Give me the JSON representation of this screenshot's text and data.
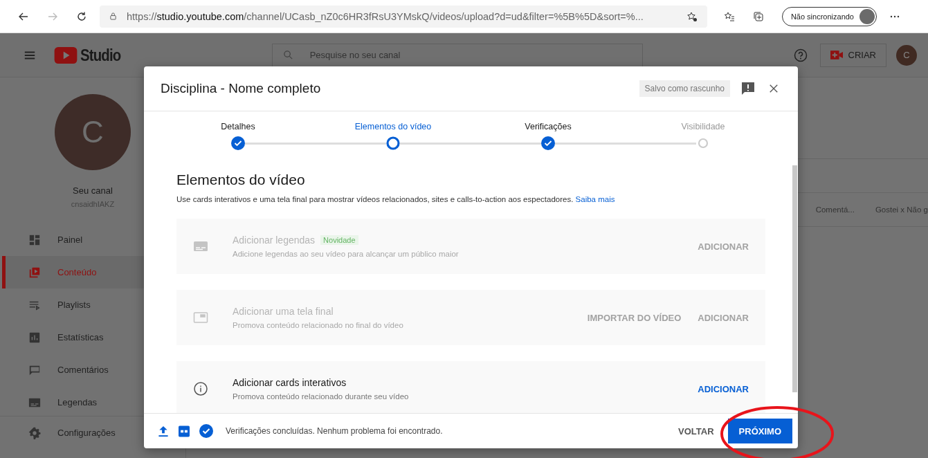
{
  "browser": {
    "url": "https://**studio.youtube.com**/channel/UCasb_nZ0c6HR3fRsU3YMskQ/videos/upload?d=ud&filter=%5B%5D&sort=%...",
    "forward_disabled": true,
    "profile": "Não sincronizando"
  },
  "header": {
    "logo": "Studio",
    "search_placeholder": "Pesquise no seu canal",
    "create": "CRIAR",
    "avatar": "C"
  },
  "channel": {
    "avatar": "C",
    "name": "Seu canal",
    "handle": "cnsaidhIAKZ"
  },
  "sidebar": {
    "items": [
      {
        "label": "Painel",
        "kind": "dashboard",
        "selected": false
      },
      {
        "label": "Conteúdo",
        "kind": "content",
        "selected": true
      },
      {
        "label": "Playlists",
        "kind": "playlist",
        "selected": false
      },
      {
        "label": "Estatísticas",
        "kind": "stats",
        "selected": false
      },
      {
        "label": "Comentários",
        "kind": "comment",
        "selected": false
      },
      {
        "label": "Legendas",
        "kind": "subtitles",
        "selected": false
      }
    ],
    "bottom_items": [
      {
        "label": "Configurações",
        "kind": "gear",
        "selected": false
      }
    ]
  },
  "table": {
    "columns": [
      "Comentá...",
      "Gostei x Não g"
    ]
  },
  "dialog": {
    "title": "Disciplina - Nome completo",
    "save_status": "Salvo como rascunho",
    "steps": [
      {
        "label": "Detalhes",
        "done": true,
        "selected": false
      },
      {
        "label": "Elementos do vídeo",
        "done": false,
        "selected": true
      },
      {
        "label": "Verificações",
        "done": true,
        "selected": false
      },
      {
        "label": "Visibilidade",
        "done": false,
        "selected": false
      }
    ],
    "heading": "Elementos do vídeo",
    "description": "Use cards interativos e uma tela final para mostrar vídeos relacionados, sites e calls-to-action aos espectadores.",
    "learn_more": "Saiba mais",
    "cards": [
      {
        "kind": "subtitles",
        "title": "Adicionar legendas",
        "badge": "Novidade",
        "subtitle": "Adicione legendas ao seu vídeo para alcançar um público maior",
        "disabled": true,
        "actions": [
          "ADICIONAR"
        ]
      },
      {
        "kind": "endscreen",
        "title": "Adicionar uma tela final",
        "subtitle": "Promova conteúdo relacionado no final do vídeo",
        "disabled": true,
        "actions": [
          "IMPORTAR DO VÍDEO",
          "ADICIONAR"
        ]
      },
      {
        "kind": "info",
        "title": "Adicionar cards interativos",
        "subtitle": "Promova conteúdo relacionado durante seu vídeo",
        "disabled": false,
        "actions": [
          "ADICIONAR"
        ]
      }
    ],
    "footer": {
      "status": "Verificações concluídas. Nenhum problema foi encontrado.",
      "back": "VOLTAR",
      "next": "PRÓXIMO"
    }
  },
  "annotation": {
    "color": "#e8141b"
  }
}
